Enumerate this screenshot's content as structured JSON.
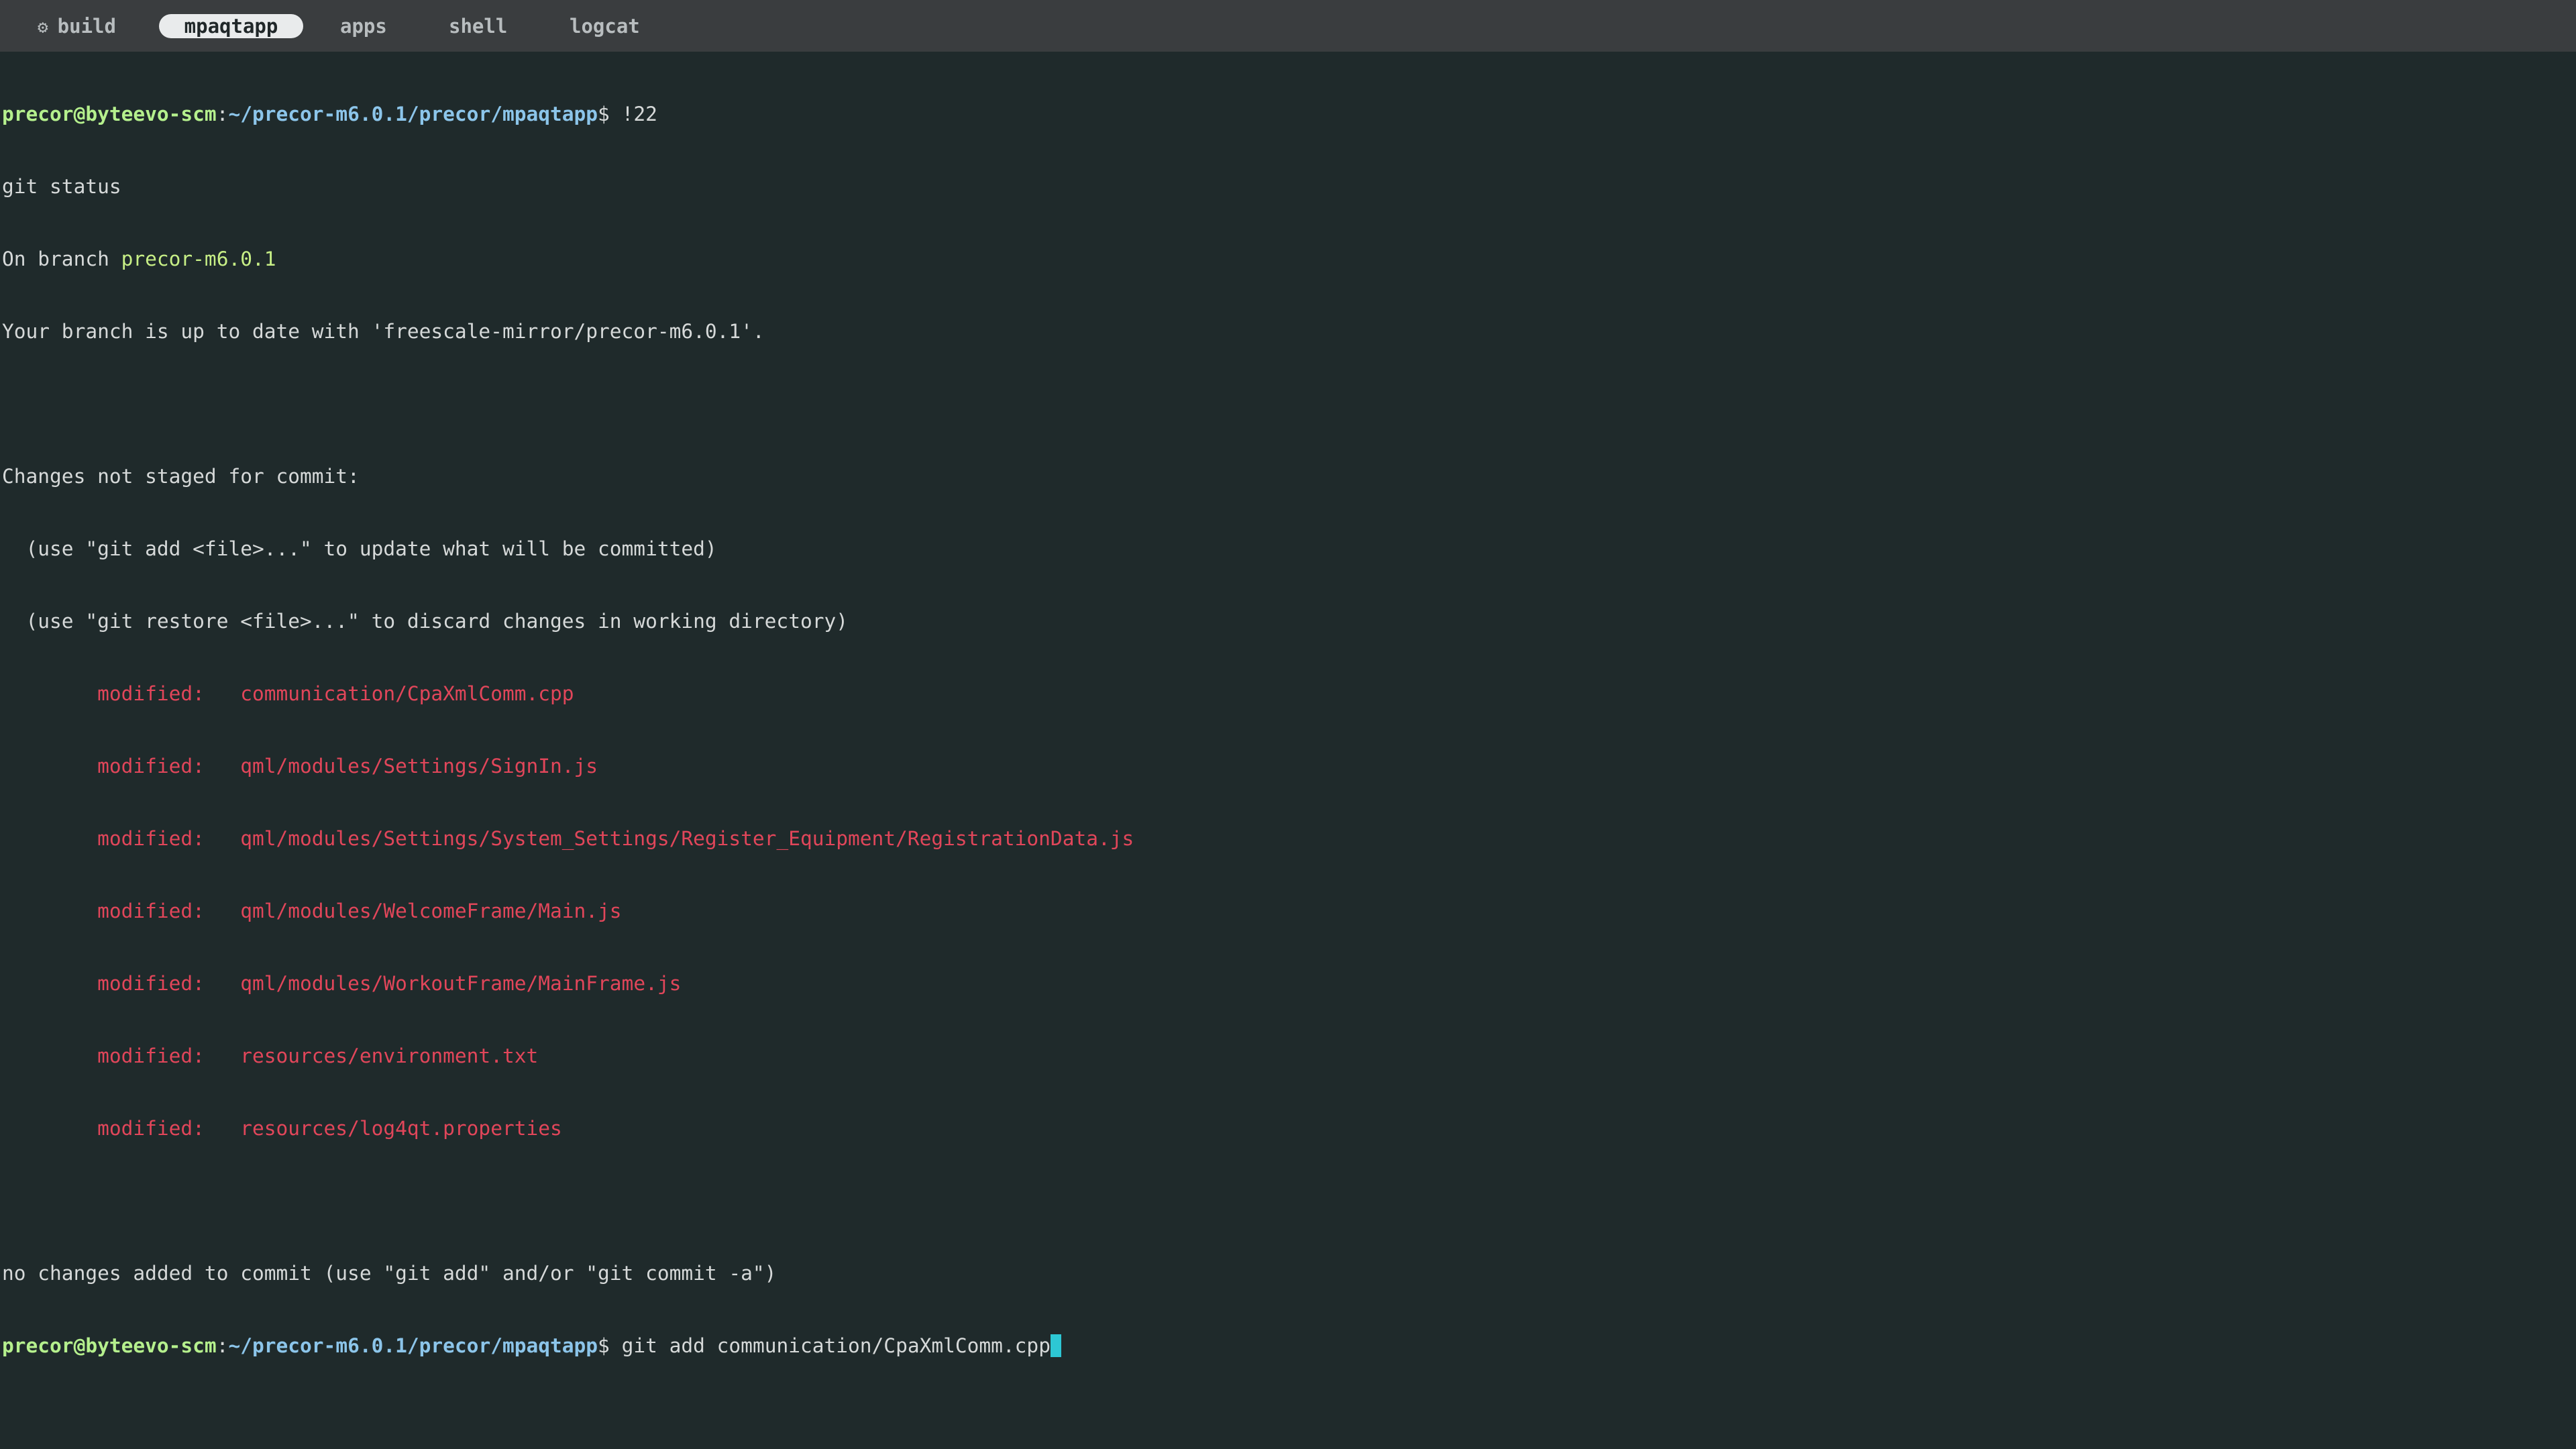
{
  "tabs": [
    {
      "label": "build",
      "icon": "gear-icon",
      "active": false
    },
    {
      "label": "mpaqtapp",
      "active": true
    },
    {
      "label": "apps",
      "active": false
    },
    {
      "label": "shell",
      "active": false
    },
    {
      "label": "logcat",
      "active": false
    }
  ],
  "terminal": {
    "prompt_user_host": "precor@byteevo-scm",
    "prompt_sep": ":",
    "prompt_path": "~/precor-m6.0.1/precor/mpaqtapp",
    "prompt_dollar": "$ ",
    "cmd1": "!22",
    "echo_cmd": "git status",
    "on_branch_prefix": "On branch ",
    "branch": "precor-m6.0.1",
    "up_to_date": "Your branch is up to date with 'freescale-mirror/precor-m6.0.1'.",
    "not_staged_header": "Changes not staged for commit:",
    "hint_add": "  (use \"git add <file>...\" to update what will be committed)",
    "hint_restore": "  (use \"git restore <file>...\" to discard changes in working directory)",
    "modified_label": "        modified:   ",
    "modified_files": [
      "communication/CpaXmlComm.cpp",
      "qml/modules/Settings/SignIn.js",
      "qml/modules/Settings/System_Settings/Register_Equipment/RegistrationData.js",
      "qml/modules/WelcomeFrame/Main.js",
      "qml/modules/WorkoutFrame/MainFrame.js",
      "resources/environment.txt",
      "resources/log4qt.properties"
    ],
    "no_changes": "no changes added to commit (use \"git add\" and/or \"git commit -a\")",
    "current_input": "git add communication/CpaXmlComm.cpp"
  },
  "colors": {
    "background": "#1f2a2b",
    "tabbar": "#3a3d3f",
    "prompt_user": "#b5f08d",
    "prompt_path": "#8cc5ea",
    "modified": "#e1465a",
    "cursor": "#2dc7d4"
  }
}
